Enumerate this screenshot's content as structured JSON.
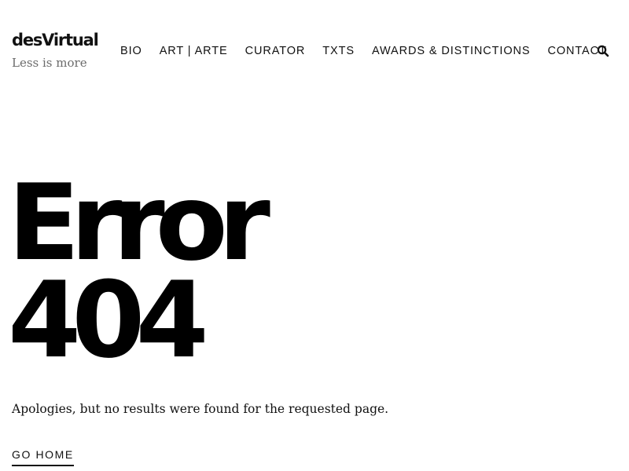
{
  "header": {
    "site_title": "desVirtual",
    "tagline": "Less is more",
    "nav_items": [
      {
        "label": "BIO"
      },
      {
        "label": "ART | ARTE"
      },
      {
        "label": "CURATOR"
      },
      {
        "label": "TXTS"
      },
      {
        "label": "AWARDS & DISTINCTIONS"
      },
      {
        "label": "CONTACT"
      }
    ],
    "search_icon": "search-icon"
  },
  "error": {
    "heading_line_1": "Error",
    "heading_line_2": "404",
    "message": "Apologies, but no results were found for the requested page.",
    "go_home_label": "GO HOME"
  },
  "colors": {
    "text": "#111111",
    "tagline": "#6b6b6b",
    "background": "#ffffff"
  }
}
